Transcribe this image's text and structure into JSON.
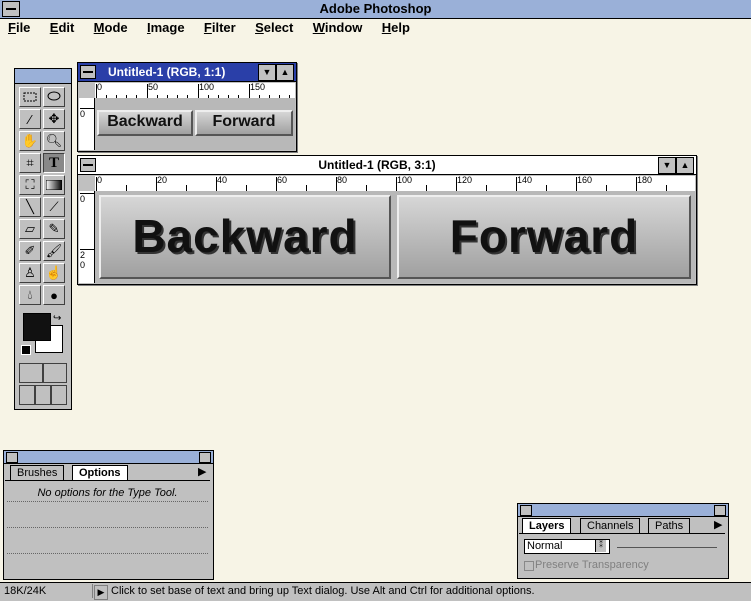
{
  "app": {
    "title": "Adobe Photoshop"
  },
  "menu": [
    "File",
    "Edit",
    "Mode",
    "Image",
    "Filter",
    "Select",
    "Window",
    "Help"
  ],
  "doc_small": {
    "title": "Untitled-1  (RGB, 1:1)",
    "ruler_labels": [
      "0",
      "50",
      "100",
      "150"
    ],
    "vruler_labels": [
      "0"
    ],
    "buttons": [
      "Backward",
      "Forward"
    ]
  },
  "doc_big": {
    "title": "Untitled-1  (RGB, 3:1)",
    "ruler_labels": [
      "0",
      "20",
      "40",
      "60",
      "80",
      "100",
      "120",
      "140",
      "160",
      "180"
    ],
    "vruler_labels": [
      "0",
      "2",
      "0"
    ],
    "buttons": [
      "Backward",
      "Forward"
    ]
  },
  "options_palette": {
    "tabs": [
      "Brushes",
      "Options"
    ],
    "active_tab": "Options",
    "message": "No options for the Type Tool."
  },
  "layers_palette": {
    "tabs": [
      "Layers",
      "Channels",
      "Paths"
    ],
    "active_tab": "Layers",
    "mode": "Normal",
    "preserve_label": "Preserve Transparency"
  },
  "status": {
    "memory": "18K/24K",
    "hint": "Click to set base of text and bring up Text dialog.  Use Alt and Ctrl for additional options."
  },
  "colors": {
    "active_title": "#2a3fa8",
    "app_title": "#9ab0d8",
    "desktop": "#f7f4e6",
    "panel": "#c0c0c0"
  }
}
